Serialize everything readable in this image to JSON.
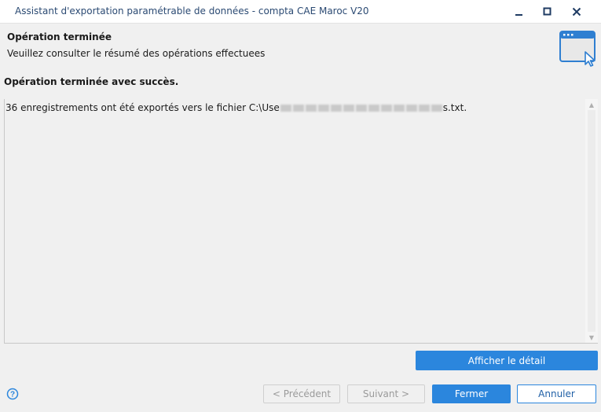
{
  "window": {
    "title": "Assistant d'exportation paramétrable de données - compta CAE Maroc V20"
  },
  "header": {
    "title": "Opération terminée",
    "subtitle": "Veuillez consulter le résumé des opérations effectuees",
    "icon": "window-cursor-icon"
  },
  "status": {
    "message": "Opération terminée avec succès."
  },
  "log": {
    "text_prefix": "36 enregistrements ont été exportés vers le fichier C:\\Use",
    "text_suffix": "s.txt."
  },
  "buttons": {
    "detail_label": "Afficher le détail",
    "prev_label": "< Précédent",
    "next_label": "Suivant >",
    "finish_label": "Fermer",
    "cancel_label": "Annuler"
  },
  "colors": {
    "accent": "#2b86dd",
    "title_text": "#2b4a73"
  }
}
